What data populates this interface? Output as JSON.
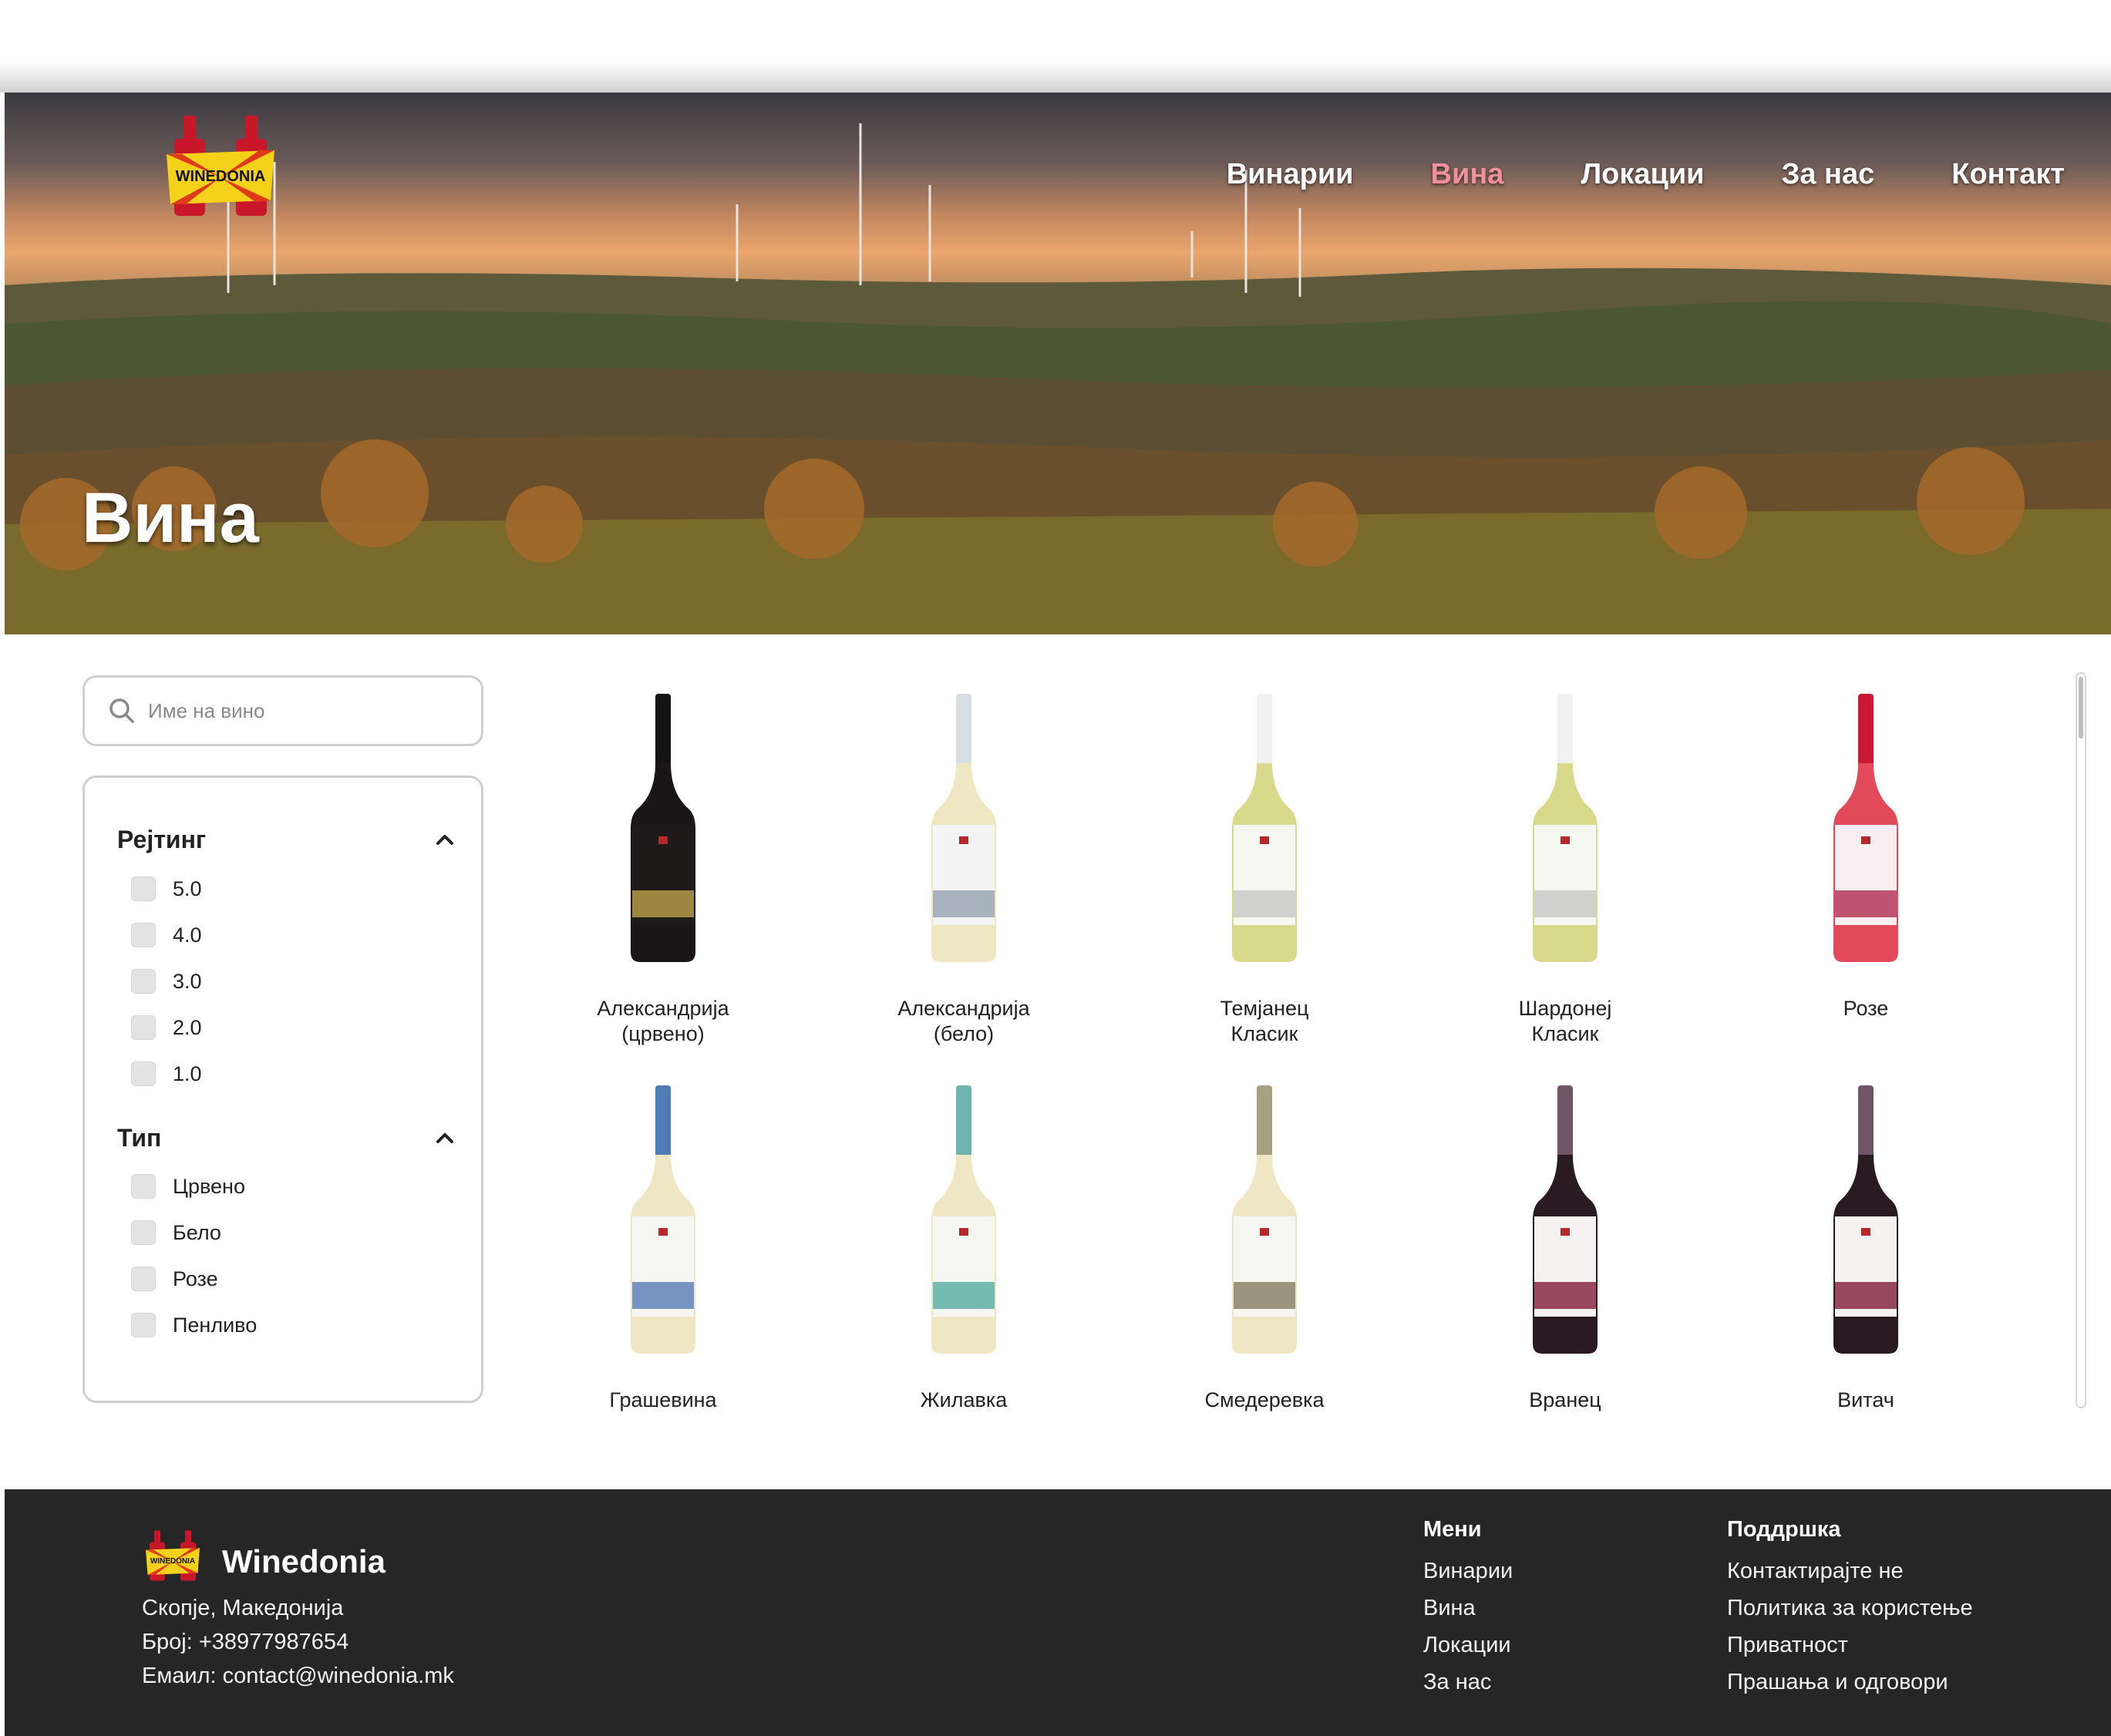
{
  "nav": {
    "items": [
      "Винарии",
      "Вина",
      "Локации",
      "За нас",
      "Контакт"
    ],
    "active": "Вина",
    "logo_text": "WINEDONIA"
  },
  "hero": {
    "title": "Вина"
  },
  "search": {
    "placeholder": "Име на вино"
  },
  "filters": {
    "rating": {
      "title": "Рејтинг",
      "options": [
        "5.0",
        "4.0",
        "3.0",
        "2.0",
        "1.0"
      ]
    },
    "type": {
      "title": "Тип",
      "options": [
        "Црвено",
        "Бело",
        "Розе",
        "Пенливо"
      ]
    }
  },
  "wines": [
    {
      "name": "Александрија\n(црвено)",
      "color": "red-dark"
    },
    {
      "name": "Александрија\n(бело)",
      "color": "white"
    },
    {
      "name": "Темјанец\nКласик",
      "color": "green-white"
    },
    {
      "name": "Шардонеј\nКласик",
      "color": "green-white"
    },
    {
      "name": "Розе",
      "color": "rose"
    },
    {
      "name": "Грашевина",
      "color": "blue-white"
    },
    {
      "name": "Жилавка",
      "color": "teal-white"
    },
    {
      "name": "Смедеревка",
      "color": "olive-white"
    },
    {
      "name": "Вранец",
      "color": "red"
    },
    {
      "name": "Витач",
      "color": "red"
    }
  ],
  "footer": {
    "brand": "Winedonia",
    "address": "Скопје, Македонија",
    "phone": "Број: +38977987654",
    "email": "Емаил: contact@winedonia.mk",
    "menu_title": "Мени",
    "menu": [
      "Винарии",
      "Вина",
      "Локации",
      "За нас"
    ],
    "support_title": "Поддршка",
    "support": [
      "Контактирајте не",
      "Политика за користење",
      "Приватност",
      "Прашања и одговори"
    ]
  },
  "colors": {
    "accent": "#f08f9e",
    "footer_bg": "#262626"
  }
}
